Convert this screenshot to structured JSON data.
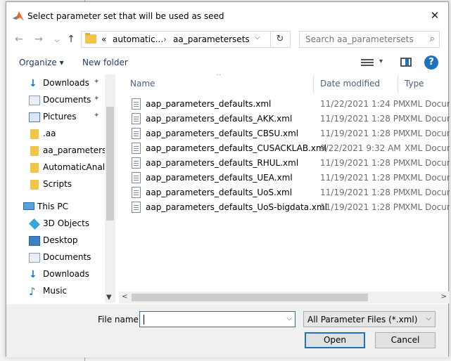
{
  "window": {
    "title": "Select parameter set that will be used as seed",
    "close_symbol": "✕"
  },
  "nav": {
    "back_symbol": "←",
    "forward_symbol": "→",
    "up_symbol": "↑",
    "breadcrumb": [
      "«",
      "automatic...",
      "›",
      "aa_parametersets"
    ],
    "dropdown_symbol": "⌵",
    "refresh_symbol": "↻",
    "search_placeholder": "Search aa_parametersets",
    "search_symbol": "⌕"
  },
  "toolbar": {
    "organize_label": "Organize ▾",
    "new_folder_label": "New folder",
    "view_dropdown_symbol": "▾",
    "help_symbol": "?"
  },
  "sidebar": {
    "items": [
      {
        "label": "Downloads",
        "icon": "downloads-icon",
        "pinned": true
      },
      {
        "label": "Documents",
        "icon": "documents-icon",
        "pinned": true
      },
      {
        "label": "Pictures",
        "icon": "pictures-icon",
        "pinned": true
      },
      {
        "label": ".aa",
        "icon": "folder-icon",
        "pinned": false
      },
      {
        "label": "aa_parameterset",
        "icon": "folder-icon",
        "pinned": false
      },
      {
        "label": "AutomaticAnaly",
        "icon": "folder-icon",
        "pinned": false
      },
      {
        "label": "Scripts",
        "icon": "folder-icon",
        "pinned": false
      },
      {
        "label": "This PC",
        "icon": "this-pc-icon",
        "pinned": false
      },
      {
        "label": "3D Objects",
        "icon": "3d-objects-icon",
        "pinned": false
      },
      {
        "label": "Desktop",
        "icon": "desktop-icon",
        "pinned": false
      },
      {
        "label": "Documents",
        "icon": "documents-icon",
        "pinned": false
      },
      {
        "label": "Downloads",
        "icon": "downloads-icon",
        "pinned": false
      },
      {
        "label": "Music",
        "icon": "music-icon",
        "pinned": false
      }
    ],
    "pin_symbol": "📌",
    "scroll_down_symbol": "⌄"
  },
  "files": {
    "columns": {
      "name": "Name",
      "date": "Date modified",
      "type": "Type"
    },
    "sort_symbol": "^",
    "rows": [
      {
        "name": "aap_parameters_defaults.xml",
        "date": "11/22/2021 1:24 PM",
        "type": "XML Document"
      },
      {
        "name": "aap_parameters_defaults_AKK.xml",
        "date": "11/19/2021 1:28 PM",
        "type": "XML Document"
      },
      {
        "name": "aap_parameters_defaults_CBSU.xml",
        "date": "11/19/2021 1:28 PM",
        "type": "XML Document"
      },
      {
        "name": "aap_parameters_defaults_CUSACKLAB.xml",
        "date": "9/22/2021 9:32 AM",
        "type": "XML Document"
      },
      {
        "name": "aap_parameters_defaults_RHUL.xml",
        "date": "11/19/2021 1:28 PM",
        "type": "XML Document"
      },
      {
        "name": "aap_parameters_defaults_UEA.xml",
        "date": "11/19/2021 1:28 PM",
        "type": "XML Document"
      },
      {
        "name": "aap_parameters_defaults_UoS.xml",
        "date": "11/19/2021 1:28 PM",
        "type": "XML Document"
      },
      {
        "name": "aap_parameters_defaults_UoS-bigdata.xml",
        "date": "11/19/2021 1:28 PM",
        "type": "XML Document"
      }
    ],
    "scroll_left_symbol": "<",
    "scroll_right_symbol": ">"
  },
  "footer": {
    "file_name_label": "File name:",
    "file_name_value": "",
    "file_name_dropdown_symbol": "⌵",
    "file_type_value": "All Parameter Files (*.xml)",
    "file_type_dropdown_symbol": "⌵",
    "open_label": "Open",
    "cancel_label": "Cancel"
  },
  "colors": {
    "accent": "#1e73be",
    "folder": "#f3c44a"
  }
}
